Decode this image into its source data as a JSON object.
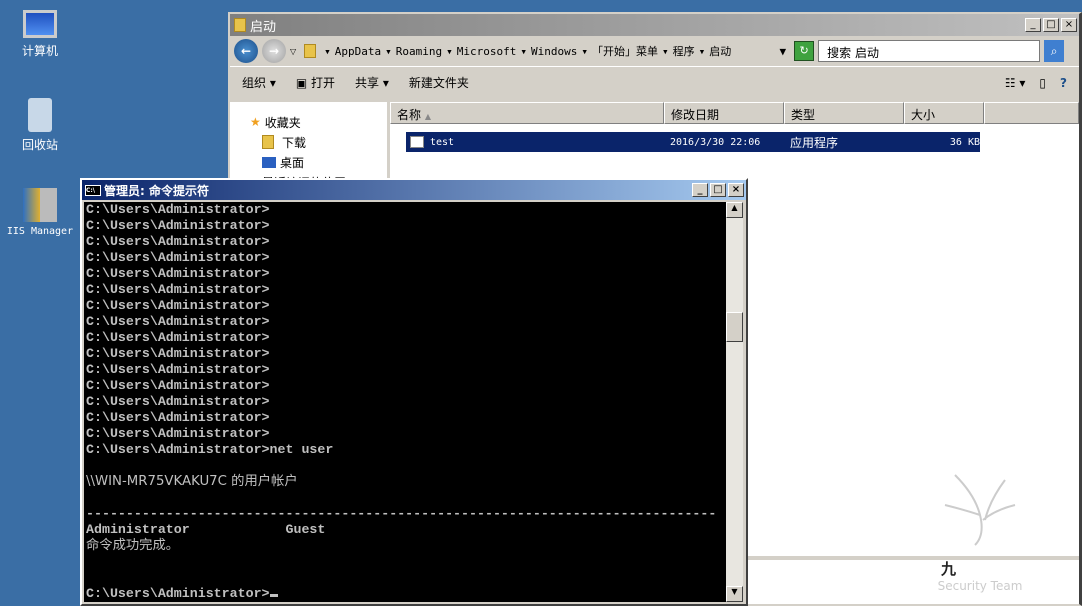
{
  "desktop": {
    "icons": [
      {
        "label": "计算机"
      },
      {
        "label": "回收站"
      },
      {
        "label": "IIS Manager"
      }
    ]
  },
  "explorer": {
    "title": "启动",
    "breadcrumb": [
      "AppData",
      "Roaming",
      "Microsoft",
      "Windows",
      "「开始」菜单",
      "程序",
      "启动"
    ],
    "search_placeholder": "搜索 启动",
    "toolbar": {
      "organize": "组织",
      "open": "打开",
      "share": "共享",
      "new_folder": "新建文件夹"
    },
    "nav": [
      "收藏夹",
      "下载",
      "桌面",
      "最近访问的位置"
    ],
    "columns": [
      "名称",
      "修改日期",
      "类型",
      "大小"
    ],
    "files": [
      {
        "name": "test",
        "modified": "2016/3/30 22:06",
        "type": "应用程序",
        "size": "36 KB"
      }
    ]
  },
  "cmd": {
    "title": "管理员: 命令提示符",
    "prompt": "C:\\Users\\Administrator>",
    "lines": [
      "C:\\Users\\Administrator>",
      "C:\\Users\\Administrator>",
      "C:\\Users\\Administrator>",
      "C:\\Users\\Administrator>",
      "C:\\Users\\Administrator>",
      "C:\\Users\\Administrator>",
      "C:\\Users\\Administrator>",
      "C:\\Users\\Administrator>",
      "C:\\Users\\Administrator>",
      "C:\\Users\\Administrator>",
      "C:\\Users\\Administrator>",
      "C:\\Users\\Administrator>",
      "C:\\Users\\Administrator>",
      "C:\\Users\\Administrator>",
      "C:\\Users\\Administrator>",
      "C:\\Users\\Administrator>net user",
      "",
      "\\\\WIN-MR75VKAKU7C 的用户帐户",
      "",
      "-------------------------------------------------------------------------------",
      "Administrator            Guest",
      "命令成功完成。",
      "",
      ""
    ]
  },
  "watermark": {
    "glyph": "九",
    "text": "Security Team"
  }
}
